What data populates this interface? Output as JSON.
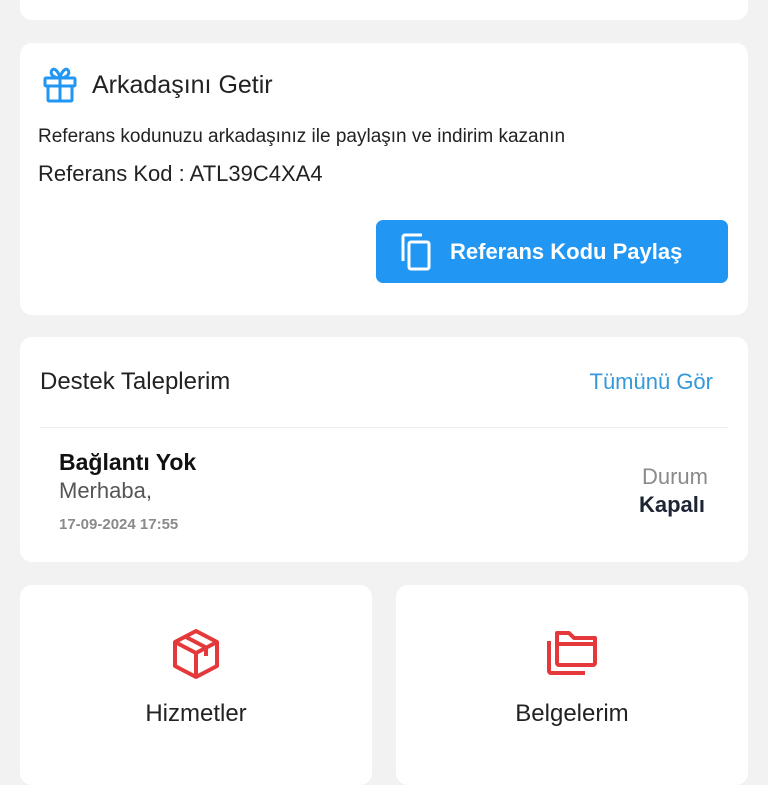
{
  "referral": {
    "title": "Arkadaşını Getir",
    "description": "Referans kodunuzu arkadaşınız ile paylaşın ve indirim kazanın",
    "code_label": "Referans Kod :",
    "code": "ATL39C4XA4",
    "share_button": "Referans Kodu Paylaş",
    "icon": "gift-icon",
    "accent_color": "#2196f3"
  },
  "support": {
    "title": "Destek Taleplerim",
    "see_all": "Tümünü Gör",
    "tickets": [
      {
        "title": "Bağlantı Yok",
        "message": "Merhaba,",
        "date": "17-09-2024 17:55",
        "status_label": "Durum",
        "status": "Kapalı"
      }
    ]
  },
  "tiles": [
    {
      "label": "Hizmetler",
      "icon": "box-icon",
      "color": "#e5383b"
    },
    {
      "label": "Belgelerim",
      "icon": "folders-icon",
      "color": "#e5383b"
    }
  ]
}
